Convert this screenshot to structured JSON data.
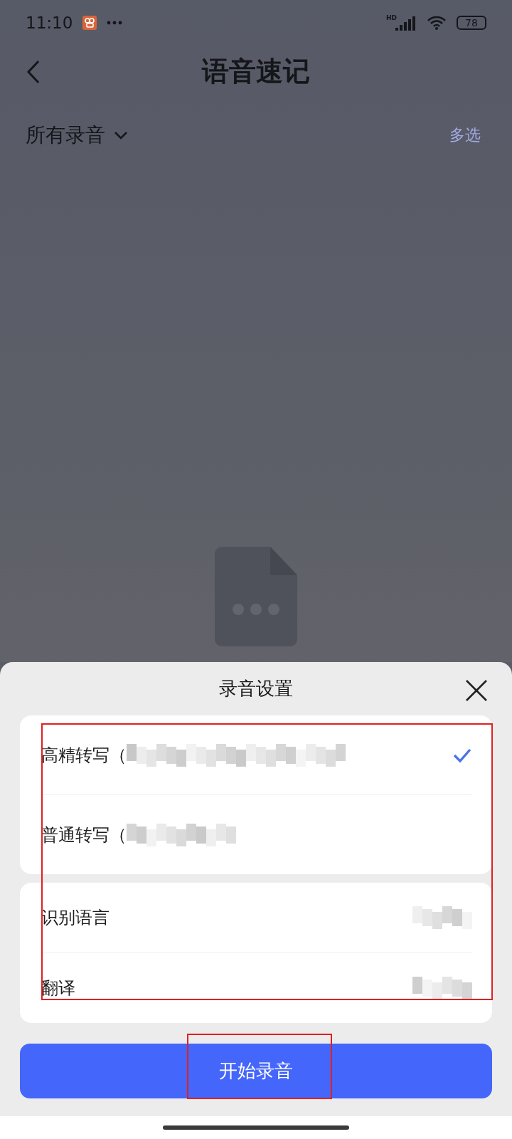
{
  "status_bar": {
    "time": "11:10",
    "network_label": "HD",
    "battery": "78"
  },
  "header": {
    "title": "语音速记"
  },
  "filter": {
    "label": "所有录音",
    "action": "多选"
  },
  "sheet": {
    "title": "录音设置",
    "modes": [
      {
        "label": "高精转写（",
        "redacted": true,
        "selected": true
      },
      {
        "label": "普通转写（",
        "redacted": true,
        "selected": false
      }
    ],
    "settings": [
      {
        "label": "识别语言",
        "redacted": true
      },
      {
        "label": "翻译",
        "redacted": true
      }
    ],
    "start_button": "开始录音",
    "options_highlighted": true,
    "start_button_highlighted": true
  }
}
